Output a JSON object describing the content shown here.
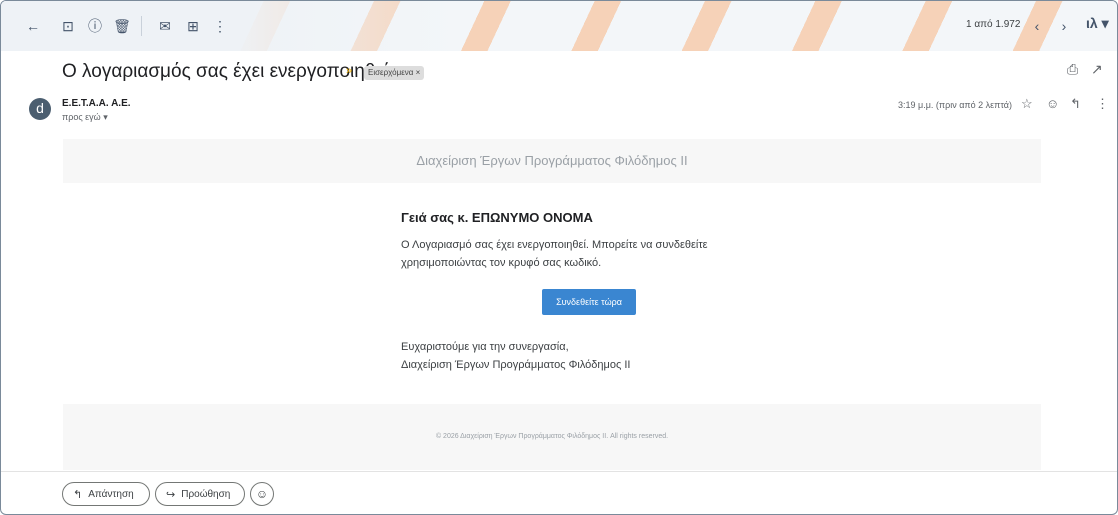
{
  "toolbar": {
    "back_icon": "←",
    "archive_icon": "⊡",
    "report_icon": "ⓘ",
    "delete_icon": "🗑",
    "mark_unread_icon": "✉",
    "move_icon": "⊞",
    "more_icon": "⋮",
    "page_count": "1 από 1.972",
    "prev_icon": "‹",
    "next_icon": "›",
    "account_glyph": "ιλ ▾"
  },
  "message": {
    "subject": "Ο λογαριασμός σας έχει ενεργοποιηθεί",
    "importance_marker": "»",
    "label": "Εισερχόμενα ×",
    "print_icon": "⎙",
    "open_new_icon": "↗",
    "avatar_letter": "d",
    "sender": "E.E.T.A.A. A.E.",
    "recipient": "προς εγώ ▾",
    "time": "3:19 μ.μ. (πριν από 2 λεπτά)",
    "star_icon": "☆",
    "emoji_icon": "☺",
    "reply_icon": "↰",
    "more_icon": "⋮"
  },
  "email": {
    "header": "Διαχείριση Έργων Προγράμματος Φιλόδημος ΙΙ",
    "greeting": "Γειά σας κ. ΕΠΩΝΥΜΟ ΟΝΟΜΑ",
    "body": "Ο Λογαριασμό σας έχει ενεργοποιηθεί. Μπορείτε να συνδεθείτε χρησιμοποιώντας τον κρυφό σας κωδικό.",
    "cta": "Συνδεθείτε τώρα",
    "thanks_line1": "Ευχαριστούμε για την συνεργασία,",
    "thanks_line2": "Διαχείριση Έργων Προγράμματος Φιλόδημος ΙΙ",
    "footer": "© 2026 Διαχείριση Έργων Προγράμματος Φιλόδημος ΙΙ. All rights reserved."
  },
  "actions": {
    "reply": "Απάντηση",
    "reply_icon": "↰",
    "forward": "Προώθηση",
    "forward_icon": "↪",
    "emoji_icon": "☺"
  }
}
